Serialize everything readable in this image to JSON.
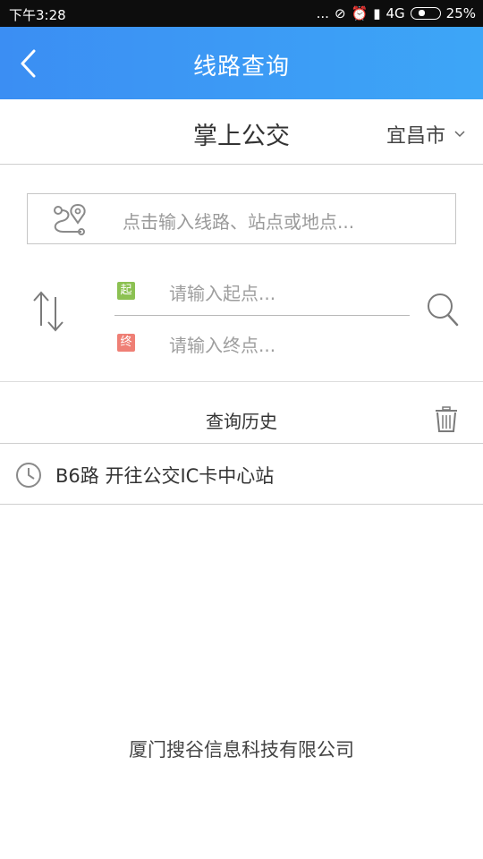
{
  "status_bar": {
    "time": "下午3:28",
    "dots": "...",
    "network": "4G",
    "battery": "25%",
    "battery_level": 0.25
  },
  "header": {
    "title": "线路查询",
    "background_color": "#3b8ef3"
  },
  "subheader": {
    "app_title": "掌上公交",
    "city": "宜昌市"
  },
  "search": {
    "placeholder": "点击输入线路、站点或地点..."
  },
  "trip": {
    "start_badge": "起",
    "start_placeholder": "请输入起点...",
    "end_badge": "终",
    "end_placeholder": "请输入终点...",
    "start_color": "#8cc152",
    "end_color": "#ef7f75"
  },
  "history": {
    "title": "查询历史",
    "items": [
      {
        "label": "B6路 开往公交IC卡中心站"
      }
    ]
  },
  "footer": {
    "company": "厦门搜谷信息科技有限公司"
  }
}
